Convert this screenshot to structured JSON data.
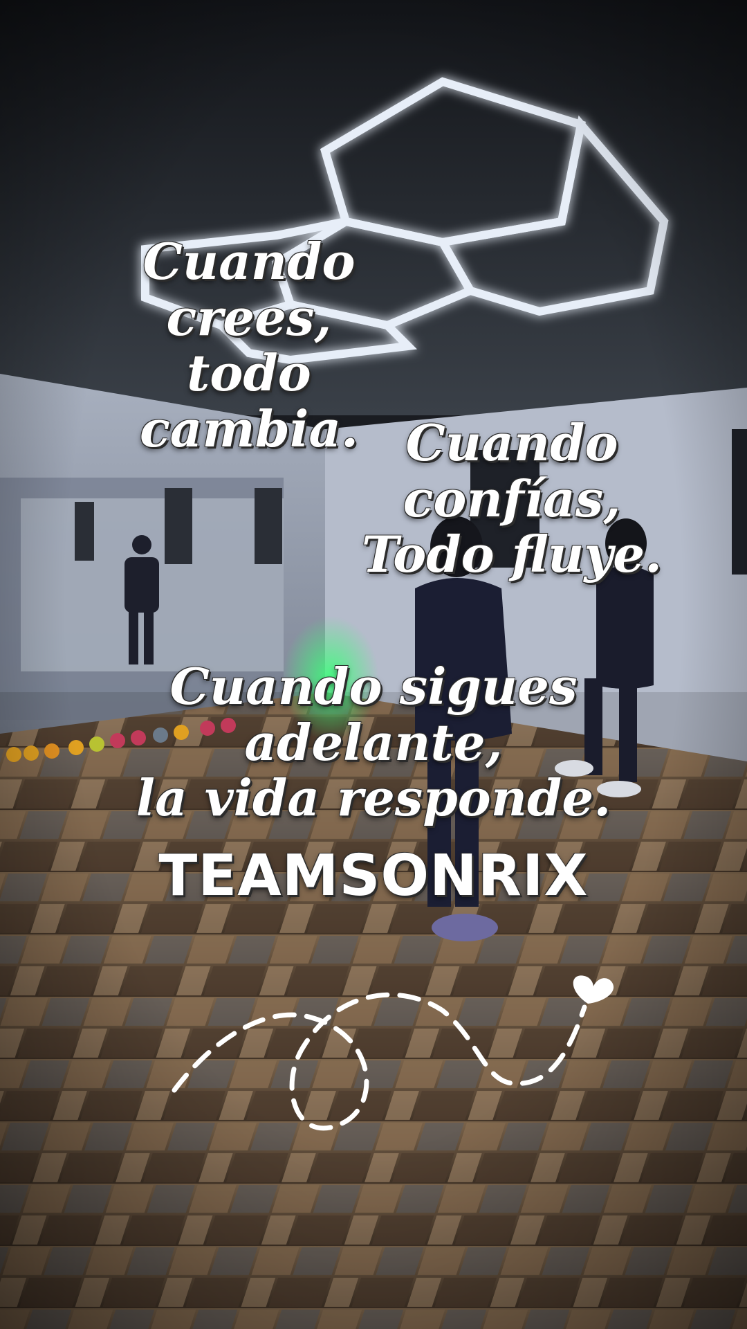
{
  "overlay": {
    "phrase_1": {
      "line_1": "Cuando crees,",
      "line_2": "todo cambia."
    },
    "phrase_2": {
      "line_1": "Cuando confías,",
      "line_2": "Todo fluye."
    },
    "phrase_3": {
      "line_1": "Cuando sigues adelante,",
      "line_2": "la vida responde."
    },
    "brand": "TEAMSONRIX"
  },
  "decorations": {
    "dashed_path_icon": "dashed-loop-trail-icon",
    "heart_icon": "heart-icon",
    "ceiling_light_icon": "hexagon-led-light-icon"
  },
  "colors": {
    "text": "#ffffff",
    "text_outline": "#2b2b2b",
    "led_glow": "#dfe8f5",
    "wall": "#9aa3b3",
    "floor": "#6b5440"
  }
}
